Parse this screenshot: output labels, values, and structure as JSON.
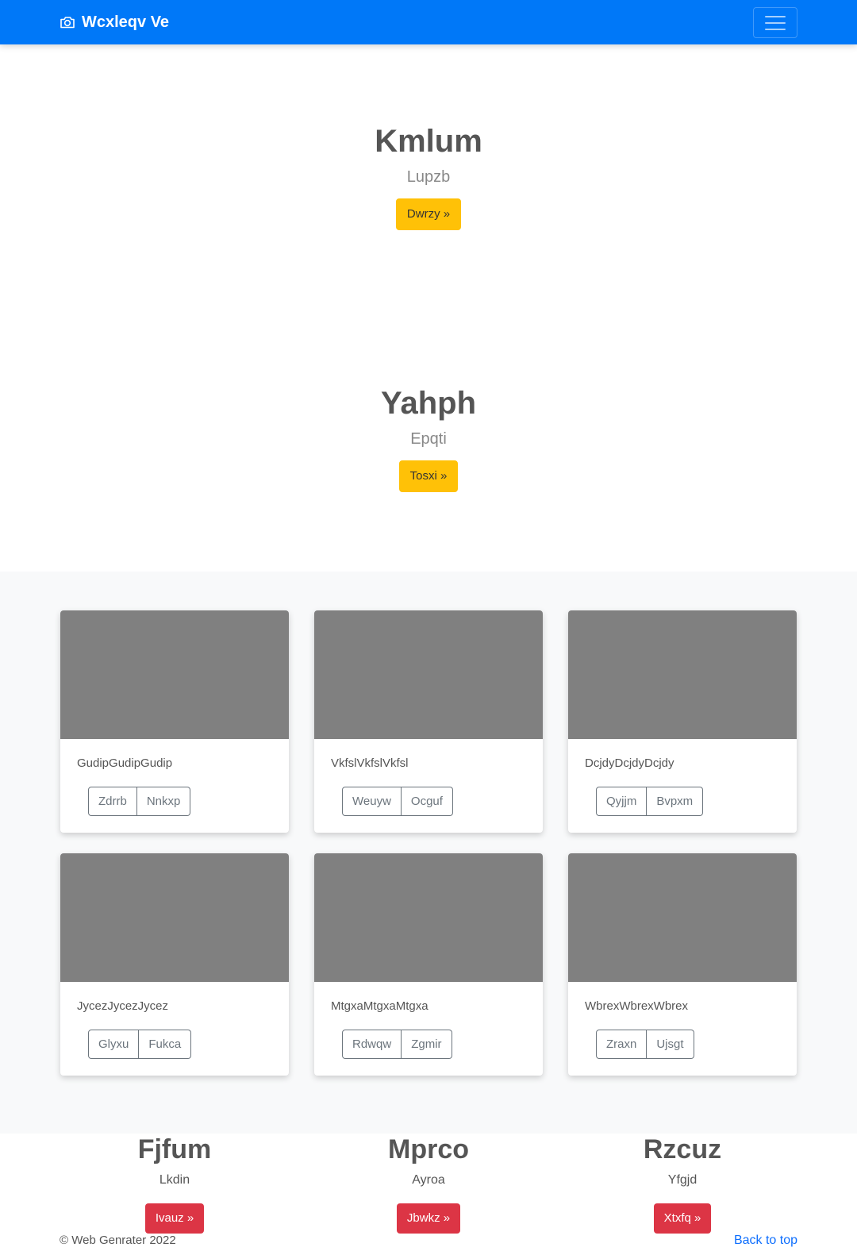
{
  "navbar": {
    "brand": "Wcxleqv Ve"
  },
  "heroes": [
    {
      "title": "Kmlum",
      "subtitle": "Lupzb",
      "button": "Dwrzy »"
    },
    {
      "title": "Yahph",
      "subtitle": "Epqti",
      "button": "Tosxi »"
    }
  ],
  "cards": [
    {
      "text": "GudipGudipGudip",
      "buttons": [
        "Zdrrb",
        "Nnkxp"
      ]
    },
    {
      "text": "VkfslVkfslVkfsl",
      "buttons": [
        "Weuyw",
        "Ocguf"
      ]
    },
    {
      "text": "DcjdyDcjdyDcjdy",
      "buttons": [
        "Qyjjm",
        "Bvpxm"
      ]
    },
    {
      "text": "JycezJycezJycez",
      "buttons": [
        "Glyxu",
        "Fukca"
      ]
    },
    {
      "text": "MtgxaMtgxaMtgxa",
      "buttons": [
        "Rdwqw",
        "Zgmir"
      ]
    },
    {
      "text": "WbrexWbrexWbrex",
      "buttons": [
        "Zraxn",
        "Ujsgt"
      ]
    }
  ],
  "features": [
    {
      "title": "Fjfum",
      "text": "Lkdin",
      "button": "Ivauz »"
    },
    {
      "title": "Mprco",
      "text": "Ayroa",
      "button": "Jbwkz »"
    },
    {
      "title": "Rzcuz",
      "text": "Yfgjd",
      "button": "Xtxfq »"
    }
  ],
  "footer": {
    "copyright": "© Web Genrater 2022",
    "back_to_top": "Back to top"
  }
}
